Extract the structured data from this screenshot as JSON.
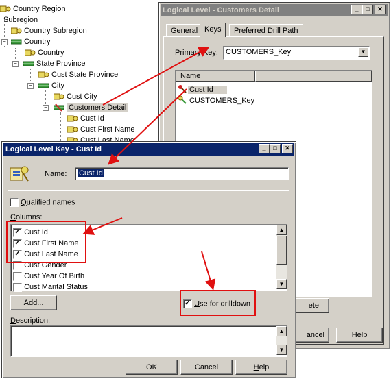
{
  "tree": {
    "items": [
      {
        "label": "Country Region"
      },
      {
        "label": "Subregion"
      },
      {
        "label": "Country Subregion"
      },
      {
        "label": "Country"
      },
      {
        "label": "Country"
      },
      {
        "label": "State Province"
      },
      {
        "label": "Cust State Province"
      },
      {
        "label": "City"
      },
      {
        "label": "Cust City"
      },
      {
        "label": "Customers Detail"
      },
      {
        "label": "Cust Id"
      },
      {
        "label": "Cust First Name"
      },
      {
        "label": "Cust Last Name"
      }
    ]
  },
  "bg_window": {
    "title": "Logical Level - Customers Detail",
    "tabs": [
      {
        "label": "General"
      },
      {
        "label": "Keys"
      },
      {
        "label": "Preferred Drill Path"
      }
    ],
    "primary_key_label": "Primary Key:",
    "primary_key_value": "CUSTOMERS_Key",
    "list_header": "Name",
    "list_items": [
      {
        "label": "Cust Id"
      },
      {
        "label": "CUSTOMERS_Key"
      }
    ],
    "delete_partial": "ete",
    "cancel_partial": "ancel",
    "help_label": "Help"
  },
  "fg_window": {
    "title": "Logical Level Key - Cust Id",
    "name_label": "Name:",
    "name_value": "Cust Id",
    "qualified_names_label": "Qualified names",
    "qualified_names_checked": false,
    "columns_label": "Columns:",
    "columns": [
      {
        "label": "Cust Id",
        "checked": true
      },
      {
        "label": "Cust First Name",
        "checked": true
      },
      {
        "label": "Cust Last Name",
        "checked": true
      },
      {
        "label": "Cust Gender",
        "checked": false
      },
      {
        "label": "Cust Year Of Birth",
        "checked": false
      },
      {
        "label": "Cust Marital Status",
        "checked": false
      }
    ],
    "add_button": "Add...",
    "use_for_drilldown_label": "Use for drilldown",
    "use_for_drilldown_checked": true,
    "description_label": "Description:",
    "ok_button": "OK",
    "cancel_button": "Cancel",
    "help_button": "Help"
  },
  "colors": {
    "active_title": "#0a246a",
    "inactive_title": "#808080",
    "annotation": "#e01010",
    "dialog_face": "#d4d0c8"
  }
}
